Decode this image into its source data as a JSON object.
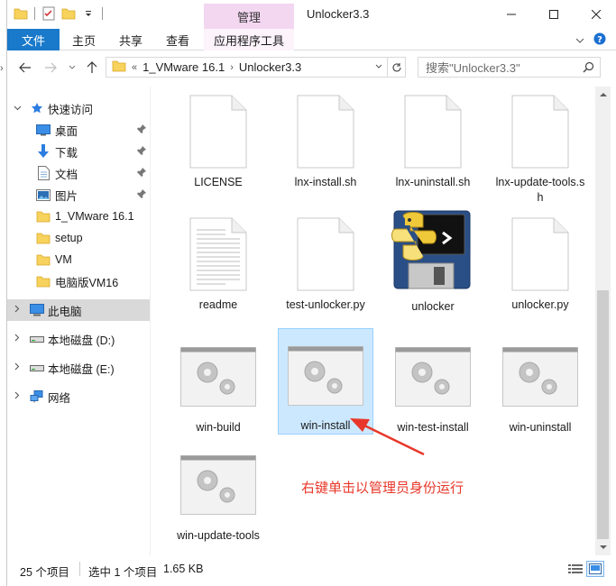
{
  "titlebar": {
    "manage_label": "管理",
    "title": "Unlocker3.3"
  },
  "ribbon": {
    "file": "文件",
    "home": "主页",
    "share": "共享",
    "view": "查看",
    "app_tools": "应用程序工具"
  },
  "address": {
    "overflow": "«",
    "segments": [
      "1_VMware 16.1",
      "Unlocker3.3"
    ],
    "search_placeholder": "搜索\"Unlocker3.3\""
  },
  "nav": {
    "quick_access": "快速访问",
    "items": [
      {
        "label": "桌面",
        "icon": "desktop-icon",
        "pinned": true
      },
      {
        "label": "下载",
        "icon": "download-icon",
        "pinned": true
      },
      {
        "label": "文档",
        "icon": "document-icon",
        "pinned": true
      },
      {
        "label": "图片",
        "icon": "picture-icon",
        "pinned": true
      },
      {
        "label": "1_VMware 16.1",
        "icon": "folder-icon",
        "pinned": false
      },
      {
        "label": "setup",
        "icon": "folder-icon",
        "pinned": false
      },
      {
        "label": "VM",
        "icon": "folder-icon",
        "pinned": false
      },
      {
        "label": "电脑版VM16",
        "icon": "folder-icon",
        "pinned": false
      }
    ],
    "this_pc": "此电脑",
    "drives": [
      "本地磁盘 (D:)",
      "本地磁盘 (E:)"
    ],
    "network": "网络"
  },
  "files": [
    {
      "name": "LICENSE",
      "icon": "blank-file-icon"
    },
    {
      "name": "lnx-install.sh",
      "icon": "blank-file-icon"
    },
    {
      "name": "lnx-uninstall.sh",
      "icon": "blank-file-icon"
    },
    {
      "name": "lnx-update-tools.sh",
      "icon": "blank-file-icon"
    },
    {
      "name": "readme",
      "icon": "text-file-icon"
    },
    {
      "name": "test-unlocker.py",
      "icon": "blank-file-icon"
    },
    {
      "name": "unlocker",
      "icon": "python-app-icon"
    },
    {
      "name": "unlocker.py",
      "icon": "blank-file-icon"
    },
    {
      "name": "win-build",
      "icon": "batch-file-icon"
    },
    {
      "name": "win-install",
      "icon": "batch-file-icon",
      "selected": true
    },
    {
      "name": "win-test-install",
      "icon": "batch-file-icon"
    },
    {
      "name": "win-uninstall",
      "icon": "batch-file-icon"
    },
    {
      "name": "win-update-tools",
      "icon": "batch-file-icon"
    }
  ],
  "status": {
    "count": "25 个项目",
    "selected": "选中 1 个项目",
    "size": "1.65 KB"
  },
  "annotation": {
    "text": "右键单击以管理员身份运行",
    "color": "#e8372a"
  },
  "colors": {
    "file_tab": "#1979ca",
    "manage_tab": "#f3d7f1",
    "selection": "#cce8ff"
  }
}
